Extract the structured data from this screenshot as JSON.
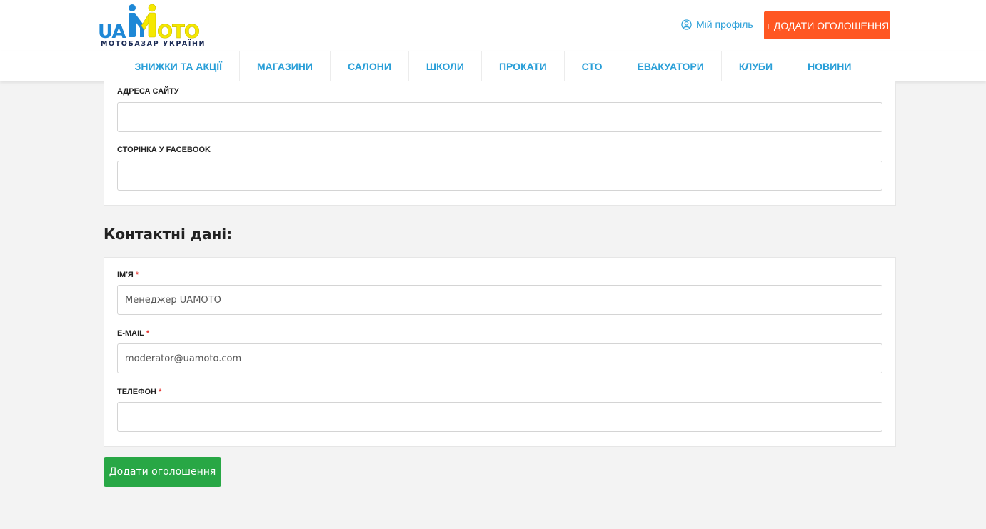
{
  "logo": {
    "left_text": "UA",
    "right_text": "OTO",
    "subtitle": "МОТОБАЗАР УКРАЇНИ",
    "colors": {
      "blue": "#1e88d6",
      "yellow": "#f5e800",
      "navy": "#1b2b55"
    }
  },
  "header": {
    "profile_icon": "user-circle-icon",
    "profile_label": "Мій профіль",
    "add_ad_label": "+ ДОДАТИ ОГОЛОШЕННЯ"
  },
  "nav": {
    "items": [
      {
        "label": "ЗНИЖКИ ТА АКЦІЇ"
      },
      {
        "label": "МАГАЗИНИ"
      },
      {
        "label": "САЛОНИ"
      },
      {
        "label": "ШКОЛИ"
      },
      {
        "label": "ПРОКАТИ"
      },
      {
        "label": "СТО"
      },
      {
        "label": "ЕВАКУАТОРИ"
      },
      {
        "label": "КЛУБИ"
      },
      {
        "label": "НОВИНИ"
      }
    ]
  },
  "site_section": {
    "website": {
      "label": "АДРЕСА САЙТУ",
      "value": ""
    },
    "facebook": {
      "label": "СТОРІНКА У FACEBOOK",
      "value": ""
    }
  },
  "contacts": {
    "title": "Контактні дані:",
    "required_mark": "*",
    "name": {
      "label": "ІМ'Я",
      "value": "Менеджер UAMOTO"
    },
    "email": {
      "label": "E-MAIL",
      "value": "moderator@uamoto.com"
    },
    "phone": {
      "label": "ТЕЛЕФОН",
      "value": ""
    }
  },
  "submit_label": "Додати оголошення",
  "colors": {
    "accent_blue": "#2a9fd8",
    "cta_orange": "#ff5722",
    "submit_green": "#28a745",
    "required_red": "#e53935"
  }
}
